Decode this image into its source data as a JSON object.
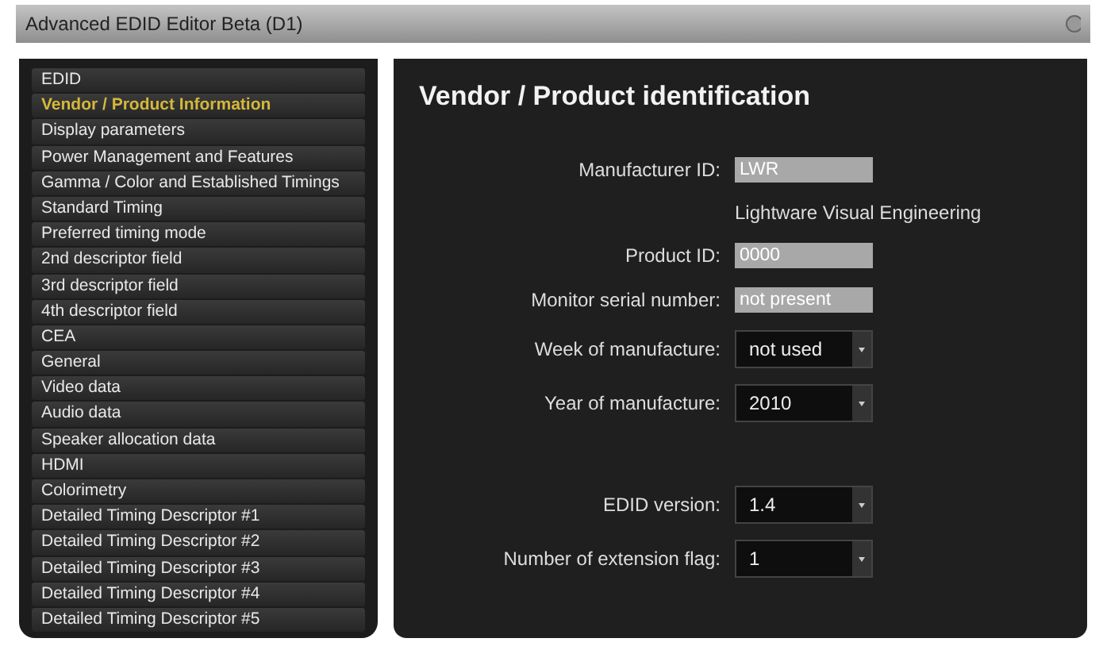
{
  "window": {
    "title": "Advanced EDID Editor Beta (D1)"
  },
  "sidebar": {
    "items": [
      {
        "label": "EDID",
        "selected": false
      },
      {
        "label": "Vendor / Product Information",
        "selected": true
      },
      {
        "label": "Display parameters",
        "selected": false
      },
      {
        "label": "Power Management and Features",
        "selected": false
      },
      {
        "label": "Gamma / Color and Established Timings",
        "selected": false
      },
      {
        "label": "Standard Timing",
        "selected": false
      },
      {
        "label": "Preferred timing mode",
        "selected": false
      },
      {
        "label": "2nd descriptor field",
        "selected": false
      },
      {
        "label": "3rd descriptor field",
        "selected": false
      },
      {
        "label": "4th descriptor field",
        "selected": false
      },
      {
        "label": "CEA",
        "selected": false
      },
      {
        "label": "General",
        "selected": false
      },
      {
        "label": "Video data",
        "selected": false
      },
      {
        "label": "Audio data",
        "selected": false
      },
      {
        "label": "Speaker allocation data",
        "selected": false
      },
      {
        "label": "HDMI",
        "selected": false
      },
      {
        "label": "Colorimetry",
        "selected": false
      },
      {
        "label": "Detailed Timing Descriptor #1",
        "selected": false
      },
      {
        "label": "Detailed Timing Descriptor #2",
        "selected": false
      },
      {
        "label": "Detailed Timing Descriptor #3",
        "selected": false
      },
      {
        "label": "Detailed Timing Descriptor #4",
        "selected": false
      },
      {
        "label": "Detailed Timing Descriptor #5",
        "selected": false
      }
    ]
  },
  "panel": {
    "title": "Vendor / Product identification",
    "rows": [
      {
        "kind": "text",
        "label": "Manufacturer ID:",
        "value": "LWR"
      },
      {
        "kind": "note",
        "value": "Lightware Visual Engineering"
      },
      {
        "kind": "text",
        "label": "Product ID:",
        "value": "0000"
      },
      {
        "kind": "text",
        "label": "Monitor serial number:",
        "value": "not present"
      },
      {
        "kind": "dropdown",
        "label": "Week of manufacture:",
        "value": "not used"
      },
      {
        "kind": "dropdown",
        "label": "Year of manufacture:",
        "value": "2010"
      },
      {
        "kind": "gap"
      },
      {
        "kind": "dropdown",
        "label": "EDID version:",
        "value": "1.4"
      },
      {
        "kind": "dropdown",
        "label": "Number of extension flag:",
        "value": "1"
      }
    ]
  }
}
